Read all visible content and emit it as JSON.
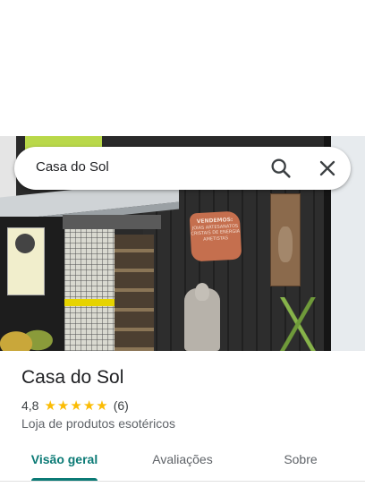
{
  "search": {
    "query": "Casa do Sol",
    "search_icon": "search-icon",
    "close_icon": "close-icon"
  },
  "photo": {
    "sign_lines": [
      "VENDEMOS:",
      "JOIAS ARTESANATOS",
      "CRISTAIS DE ENERGIA",
      "AMETISTAS"
    ]
  },
  "place": {
    "name": "Casa do Sol",
    "rating": "4,8",
    "stars": 5,
    "review_count": "(6)",
    "category": "Loja de produtos esotéricos"
  },
  "tabs": [
    {
      "label": "Visão geral",
      "active": true
    },
    {
      "label": "Avaliações",
      "active": false
    },
    {
      "label": "Sobre",
      "active": false
    }
  ],
  "colors": {
    "accent": "#0b7a75",
    "star": "#fbbc04"
  }
}
